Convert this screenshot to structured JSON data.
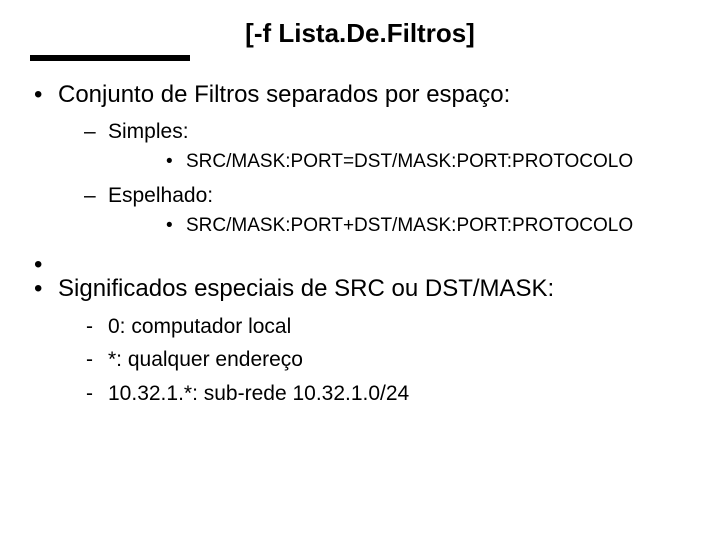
{
  "title": "[-f Lista.De.Filtros]",
  "bullets": {
    "b1": {
      "text": "Conjunto de Filtros separados por espaço:",
      "sub": {
        "s1": {
          "text": "Simples:",
          "sub": {
            "t1": "SRC/MASK:PORT=DST/MASK:PORT:PROTOCOLO"
          }
        },
        "s2": {
          "text": "Espelhado:",
          "sub": {
            "t1": "SRC/MASK:PORT+DST/MASK:PORT:PROTOCOLO"
          }
        }
      }
    },
    "b2": {
      "text": "Significados especiais de SRC ou DST/MASK:",
      "sub": {
        "s1": "0: computador local",
        "s2": "*: qualquer endereço",
        "s3": "10.32.1.*: sub-rede 10.32.1.0/24"
      }
    }
  }
}
